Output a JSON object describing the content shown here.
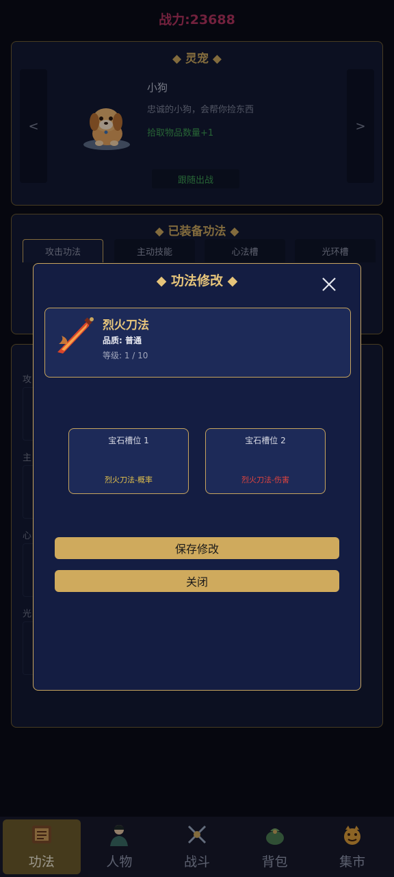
{
  "power": "战力:23688",
  "pet_panel": {
    "title": "◆ 灵宠 ◆",
    "prev": "<",
    "next": ">",
    "name": "小狗",
    "description": "忠诚的小狗，会帮你捡东西",
    "bonus": "拾取物品数量+1",
    "follow_button": "跟随出战"
  },
  "skill_panel": {
    "title": "◆ 已装备功法 ◆",
    "tabs": [
      "攻击功法",
      "主动技能",
      "心法槽",
      "光环槽"
    ]
  },
  "detail_panel": {
    "labels": [
      "攻",
      "主",
      "心",
      "光"
    ]
  },
  "modal": {
    "title": "◆ 功法修改 ◆",
    "skill": {
      "name": "烈火刀法",
      "quality": "品质: 普通",
      "level": "等级: 1 / 10"
    },
    "gems": [
      {
        "title": "宝石槽位 1",
        "item": "烈火刀法-概率"
      },
      {
        "title": "宝石槽位 2",
        "item": "烈火刀法-伤害"
      }
    ],
    "save_button": "保存修改",
    "close_button": "关闭"
  },
  "nav": [
    {
      "label": "功法",
      "icon": "scroll-icon",
      "active": true
    },
    {
      "label": "人物",
      "icon": "character-icon",
      "active": false
    },
    {
      "label": "战斗",
      "icon": "crossed-swords-icon",
      "active": false
    },
    {
      "label": "背包",
      "icon": "bag-icon",
      "active": false
    },
    {
      "label": "集市",
      "icon": "market-icon",
      "active": false
    }
  ],
  "colors": {
    "gold": "#c8a55e",
    "modal_bg": "#141d42",
    "power_text": "#b0345e",
    "bonus_green": "#3c9a52",
    "gem1_text": "#e3c14b",
    "gem2_text": "#e0443e"
  }
}
